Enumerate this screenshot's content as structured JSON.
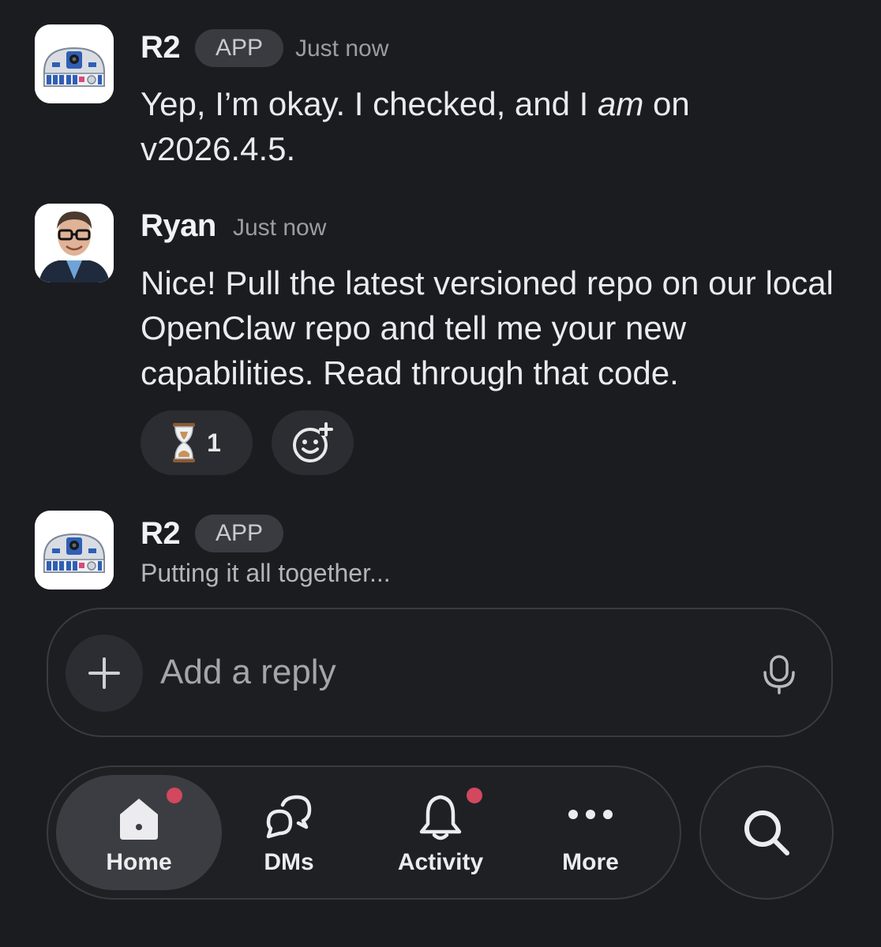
{
  "messages": [
    {
      "sender": "R2",
      "badge": "APP",
      "time": "Just now",
      "text_before": "Yep, I’m okay. I checked, and I ",
      "text_emphasis": "am",
      "text_after": " on v2026.4.5."
    },
    {
      "sender": "Ryan",
      "time": "Just now",
      "text": "Nice! Pull the latest versioned repo on our local OpenClaw repo and tell me your new capabilities. Read through that code.",
      "reactions": [
        {
          "icon": "hourglass-icon",
          "count": "1"
        }
      ]
    },
    {
      "sender": "R2",
      "badge": "APP",
      "status": "Putting it all together..."
    }
  ],
  "composer": {
    "placeholder": "Add a reply"
  },
  "nav": {
    "items": [
      {
        "label": "Home",
        "icon": "home-icon",
        "active": true,
        "notification": true
      },
      {
        "label": "DMs",
        "icon": "dms-icon",
        "active": false,
        "notification": false
      },
      {
        "label": "Activity",
        "icon": "bell-icon",
        "active": false,
        "notification": true
      },
      {
        "label": "More",
        "icon": "more-icon",
        "active": false,
        "notification": false
      }
    ]
  },
  "colors": {
    "background": "#1b1c20",
    "notification_dot": "#d1485f",
    "badge_bg": "#3a3b40"
  }
}
